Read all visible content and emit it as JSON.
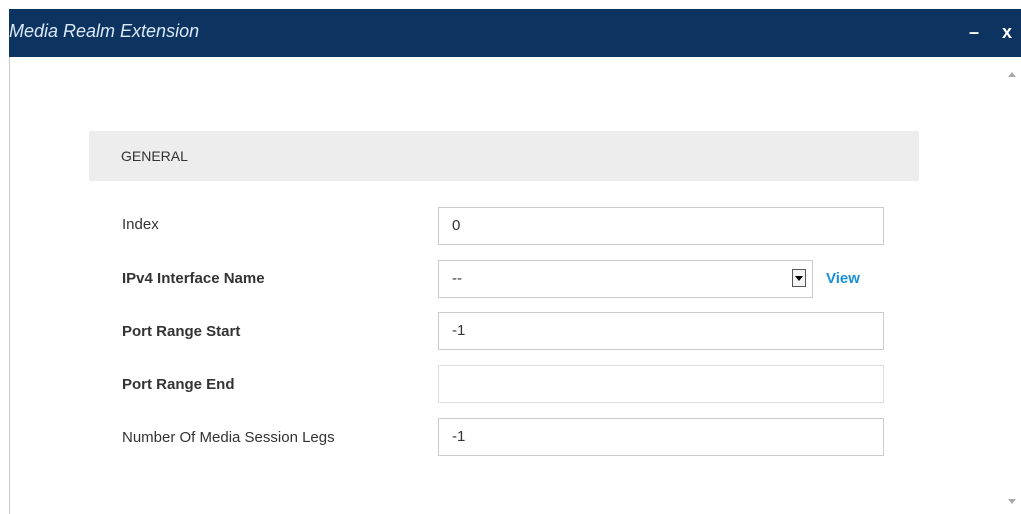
{
  "window": {
    "title": "Media Realm Extension",
    "minimize_label": "–",
    "close_label": "x"
  },
  "section": {
    "title": "GENERAL"
  },
  "fields": {
    "index": {
      "label": "Index",
      "value": "0"
    },
    "ipv4_interface_name": {
      "label": "IPv4 Interface Name",
      "value": "--",
      "link": "View"
    },
    "port_range_start": {
      "label": "Port Range Start",
      "value": "-1"
    },
    "port_range_end": {
      "label": "Port Range End",
      "value": ""
    },
    "media_session_legs": {
      "label": "Number Of Media Session Legs",
      "value": "-1"
    }
  },
  "colors": {
    "titlebar": "#0d3461",
    "section_bg": "#ededed",
    "link": "#1a8fd6"
  }
}
